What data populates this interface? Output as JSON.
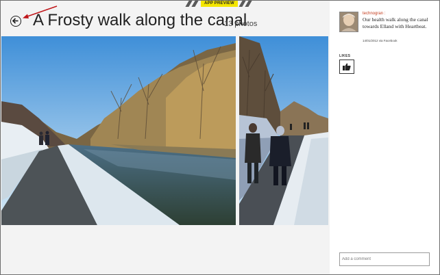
{
  "banner": {
    "label": "APP PREVIEW"
  },
  "album": {
    "title": "A Frosty walk along the canal",
    "photo_count": "13 photos"
  },
  "post": {
    "author": "technogran",
    "author_suffix": ":",
    "text": "Our health walk along the canal towards Elland with Heartbeat.",
    "meta": "14/01/2012 via Facebook"
  },
  "likes": {
    "label": "LIKES"
  },
  "comment": {
    "placeholder": "Add a comment"
  },
  "icons": {
    "back": "back-arrow-icon",
    "like": "thumbs-up-icon"
  },
  "colors": {
    "banner": "#f4e600",
    "author": "#c43b1c",
    "annotation_arrow": "#c0161a"
  }
}
